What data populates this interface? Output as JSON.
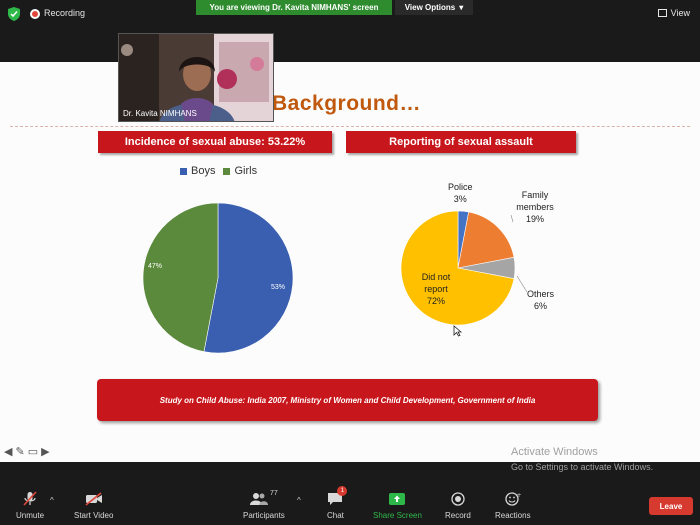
{
  "top_bar": {
    "recording_label": "Recording",
    "viewing_banner": "You are viewing Dr. Kavita NIMHANS' screen",
    "view_options_label": "View Options",
    "view_label": "View"
  },
  "video_tile": {
    "name": "Dr. Kavita NIMHANS"
  },
  "slide": {
    "title": "Background…",
    "left_heading": "Incidence of sexual abuse: 53.22%",
    "right_heading": "Reporting of sexual assault",
    "footer": "Study on Child Abuse: India 2007, Ministry of Women and Child Development, Government of India"
  },
  "chart_data": [
    {
      "type": "pie",
      "title": "Incidence of sexual abuse: 53.22%",
      "legend": [
        "Boys",
        "Girls"
      ],
      "legend_position": "top",
      "slices": [
        {
          "label": "Boys",
          "value": 53,
          "value_label": "53%",
          "color": "#3a5fb0"
        },
        {
          "label": "Girls",
          "value": 47,
          "value_label": "47%",
          "color": "#5b8a3c"
        }
      ]
    },
    {
      "type": "pie",
      "title": "Reporting of sexual assault",
      "slices": [
        {
          "label": "Police",
          "value": 3,
          "value_label": "3%",
          "color": "#4472c4"
        },
        {
          "label": "Family members",
          "value": 19,
          "value_label": "19%",
          "color": "#ed7d31"
        },
        {
          "label": "Others",
          "value": 6,
          "value_label": "6%",
          "color": "#a5a5a5"
        },
        {
          "label": "Did not report",
          "value": 72,
          "value_label": "72%",
          "color": "#ffc000"
        }
      ]
    }
  ],
  "activation": {
    "line1": "Activate Windows",
    "line2": "Go to Settings to activate Windows."
  },
  "toolbar": {
    "unmute": "Unmute",
    "start_video": "Start Video",
    "participants": "Participants",
    "participants_count": "77",
    "chat": "Chat",
    "chat_badge": "1",
    "share_screen": "Share Screen",
    "record": "Record",
    "reactions": "Reactions",
    "leave": "Leave"
  },
  "colors": {
    "banner_red": "#c8171c",
    "title_orange": "#c0580d",
    "share_green": "#2fb84a",
    "leave_red": "#d63a2f"
  }
}
